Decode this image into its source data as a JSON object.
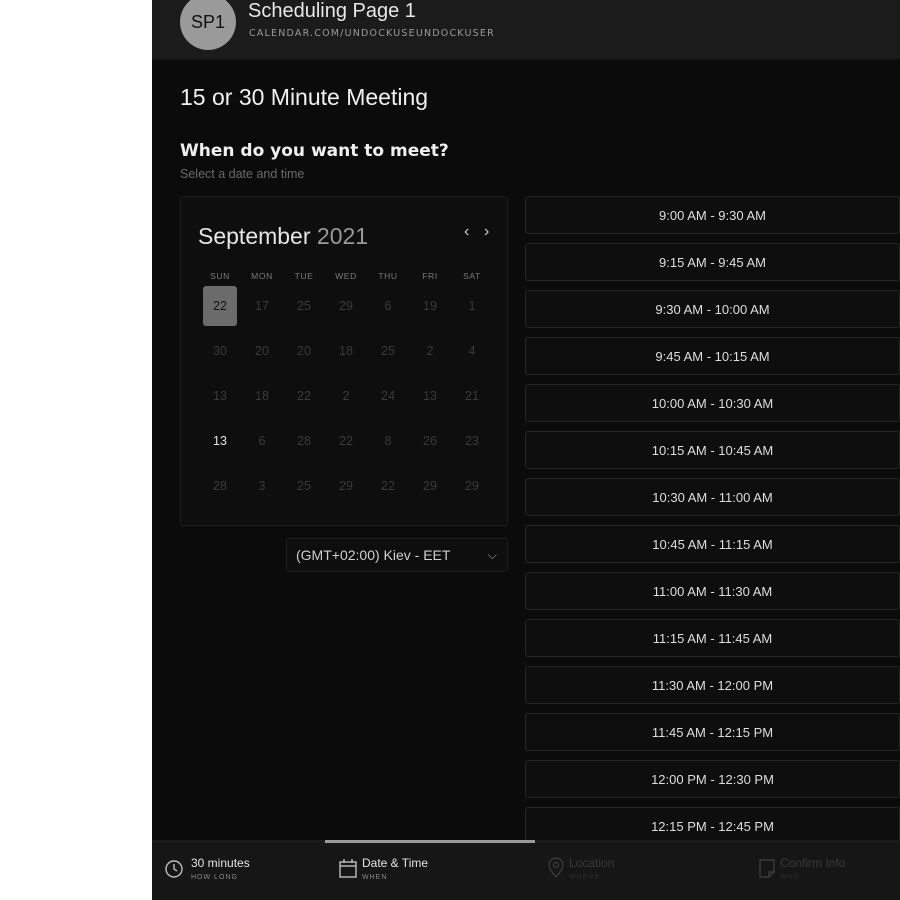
{
  "header": {
    "avatar_initials": "SP1",
    "title": "Scheduling Page 1",
    "url": "CALENDAR.COM/UNDOCKUSEUNDOCKUSER"
  },
  "meeting": {
    "title": "15 or 30 Minute Meeting",
    "question": "When do you want to meet?",
    "subtitle": "Select a date and time"
  },
  "calendar": {
    "month": "September",
    "year": "2021",
    "prev_icon": "chevron-left-icon",
    "next_icon": "chevron-right-icon",
    "days_of_week": [
      "SUN",
      "MON",
      "TUE",
      "WED",
      "THU",
      "FRI",
      "SAT"
    ],
    "weeks": [
      [
        "22",
        "17",
        "25",
        "29",
        "6",
        "19",
        "1"
      ],
      [
        "30",
        "20",
        "20",
        "18",
        "25",
        "2",
        "4"
      ],
      [
        "13",
        "18",
        "22",
        "2",
        "24",
        "13",
        "21"
      ],
      [
        "13",
        "6",
        "28",
        "22",
        "8",
        "26",
        "23"
      ],
      [
        "28",
        "3",
        "25",
        "29",
        "22",
        "29",
        "29"
      ]
    ],
    "selected": "22",
    "available": [
      "13"
    ]
  },
  "timezone": {
    "value": "(GMT+02:00) Kiev - EET",
    "icon": "chevron-down-icon"
  },
  "time_slots": [
    "9:00 AM - 9:30 AM",
    "9:15 AM - 9:45 AM",
    "9:30 AM - 10:00 AM",
    "9:45 AM - 10:15 AM",
    "10:00 AM - 10:30 AM",
    "10:15 AM - 10:45 AM",
    "10:30 AM - 11:00 AM",
    "10:45 AM - 11:15 AM",
    "11:00 AM - 11:30 AM",
    "11:15 AM - 11:45 AM",
    "11:30 AM - 12:00 PM",
    "11:45 AM - 12:15 PM",
    "12:00 PM - 12:30 PM",
    "12:15 PM - 12:45 PM"
  ],
  "progress": {
    "current_step": 2,
    "total_steps": 4
  },
  "footer": {
    "steps": [
      {
        "label": "30 minutes",
        "sub": "HOW LONG",
        "icon": "clock-icon",
        "state": "active"
      },
      {
        "label": "Date & Time",
        "sub": "WHEN",
        "icon": "calendar-icon",
        "state": "active"
      },
      {
        "label": "Location",
        "sub": "WHERE",
        "icon": "location-pin-icon",
        "state": "dim"
      },
      {
        "label": "Confirm Info",
        "sub": "WHO",
        "icon": "document-icon",
        "state": "dim"
      }
    ]
  },
  "colors": {
    "background": "#0b0b0b",
    "header_bg": "#1b1b1b",
    "selected_day": "#6b6b6b",
    "slot_border": "#262626"
  }
}
